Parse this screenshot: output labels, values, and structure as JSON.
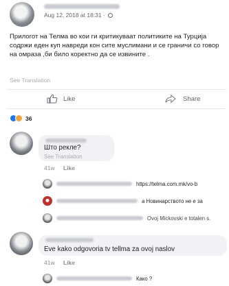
{
  "post": {
    "timestamp": "Aug 12, 2018 at 18:31 ·",
    "text": "Прилогот на Телма во кои ги критикуваат политиките на Турција содржи еден куп навреди кон сите муслимани и се граничи со говор на омраза ,би било коректно да се извините .",
    "see_translation": "See Translation",
    "like_label": "Like",
    "share_label": "Share",
    "reaction_count": "36"
  },
  "comments": [
    {
      "text": "Што рекле?",
      "see_translation": "See Translation",
      "time": "41w",
      "like_label": "Like",
      "replies": [
        {
          "text": "https://telma.com.mk/vo-b"
        },
        {
          "text": "a Новинарството не е за"
        },
        {
          "text": "Ovoj Mickovski e totalen s."
        }
      ]
    },
    {
      "text": "Eve kako odgovoria tv tellma za ovoj naslov",
      "time": "41w",
      "like_label": "Like",
      "replies": [
        {
          "text": "Како ?"
        }
      ]
    }
  ],
  "colors": {
    "like_reaction": "#1877f2",
    "love_reaction": "#f0a23b",
    "bubble": "#f0f2f5"
  },
  "icons": {
    "like": "thumbs-up-icon",
    "share": "share-arrow-icon",
    "privacy": "globe-icon"
  }
}
